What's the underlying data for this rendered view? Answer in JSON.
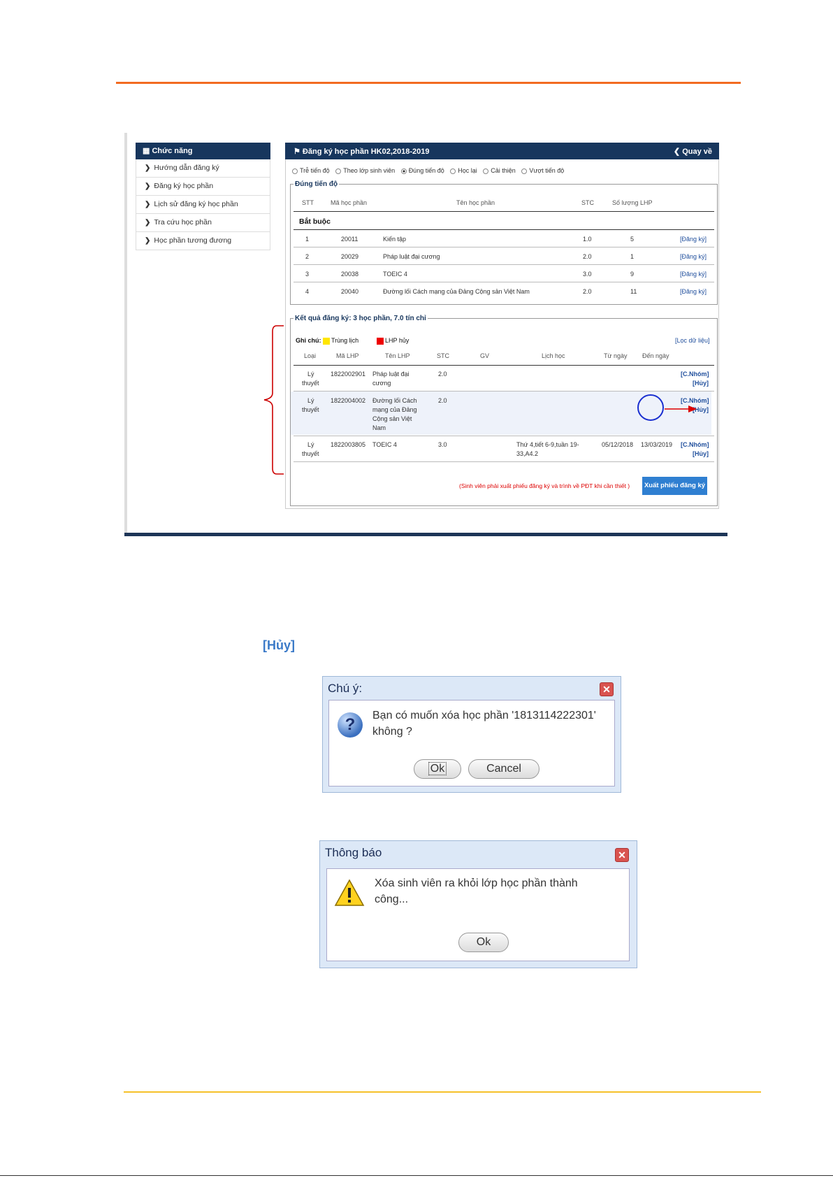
{
  "menu": {
    "title": "Chức năng",
    "items": [
      "Hướng dẫn đăng ký",
      "Đăng ký học phần",
      "Lịch sử đăng ký học phần",
      "Tra cứu học phần",
      "Học phần tương đương"
    ]
  },
  "panel": {
    "title": "Đăng ký học phần HK02,2018-2019",
    "back": "Quay về",
    "radios": [
      {
        "label": "Trễ tiến độ",
        "checked": false
      },
      {
        "label": "Theo lớp sinh viên",
        "checked": false
      },
      {
        "label": "Đúng tiến độ",
        "checked": true
      },
      {
        "label": "Học lại",
        "checked": false
      },
      {
        "label": "Cải thiện",
        "checked": false
      },
      {
        "label": "Vượt tiến độ",
        "checked": false
      }
    ]
  },
  "courses": {
    "legend": "Đúng tiến độ",
    "headers": [
      "STT",
      "Mã học phần",
      "Tên học phần",
      "STC",
      "Số lượng LHP"
    ],
    "group": "Bắt buộc",
    "action": "[Đăng ký]",
    "rows": [
      {
        "stt": "1",
        "ma": "20011",
        "ten": "Kiến tập",
        "stc": "1.0",
        "sl": "5"
      },
      {
        "stt": "2",
        "ma": "20029",
        "ten": "Pháp luật đại cương",
        "stc": "2.0",
        "sl": "1"
      },
      {
        "stt": "3",
        "ma": "20038",
        "ten": "TOEIC 4",
        "stc": "3.0",
        "sl": "9"
      },
      {
        "stt": "4",
        "ma": "20040",
        "ten": "Đường lối Cách mạng của Đảng Cộng sản Việt Nam",
        "stc": "2.0",
        "sl": "11"
      }
    ]
  },
  "results": {
    "legend": "Kết quả đăng ký: 3 học phần, 7.0 tín chỉ",
    "note_label": "Ghi chú:",
    "note_yellow": "Trùng lịch",
    "note_red": "LHP hủy",
    "filter": "[Lọc dữ liệu]",
    "headers": [
      "Loại",
      "Mã LHP",
      "Tên LHP",
      "STC",
      "GV",
      "Lịch học",
      "Từ ngày",
      "Đến ngày"
    ],
    "action_group": "[C.Nhóm]",
    "action_cancel": "[Hủy]",
    "rows": [
      {
        "loai1": "Lý",
        "loai2": "thuyết",
        "ma": "1822002901",
        "ten": [
          "Pháp luật đại",
          "cương"
        ],
        "stc": "2.0",
        "lich": [
          "",
          ""
        ],
        "tu": "",
        "den": ""
      },
      {
        "loai1": "Lý",
        "loai2": "thuyết",
        "ma": "1822004002",
        "ten": [
          "Đường lối Cách",
          "mạng của Đảng",
          "Cộng sản Việt",
          "Nam"
        ],
        "stc": "2.0",
        "lich": [
          "",
          ""
        ],
        "tu": "",
        "den": ""
      },
      {
        "loai1": "Lý",
        "loai2": "thuyết",
        "ma": "1822003805",
        "ten": [
          "TOEIC 4"
        ],
        "stc": "3.0",
        "lich": [
          "Thứ 4,tiết 6-9,tuần 19-",
          "33,A4.2"
        ],
        "tu": "05/12/2018",
        "den": "13/03/2019"
      }
    ],
    "footer_note": "(Sinh viên phải xuất phiếu đăng ký và trình về PĐT khi cần thiết )",
    "export_button": "Xuất phiếu đăng ký"
  },
  "huy_label": "[Hủy]",
  "dialog_confirm": {
    "title": "Chú ý:",
    "message_line1": "Bạn có muốn xóa học phần '1813114222301'",
    "message_line2": "không ?",
    "ok": "Ok",
    "cancel": "Cancel"
  },
  "dialog_notice": {
    "title": "Thông báo",
    "message_line1": "Xóa sinh viên ra khỏi lớp học phần thành",
    "message_line2": "công...",
    "ok": "Ok"
  },
  "colors": {
    "accent_orange": "#f26b21",
    "header_navy": "#17365d",
    "link_blue": "#1f4e9c",
    "button_blue": "#2f7fd1",
    "yellow_rule": "#f6c12a"
  }
}
